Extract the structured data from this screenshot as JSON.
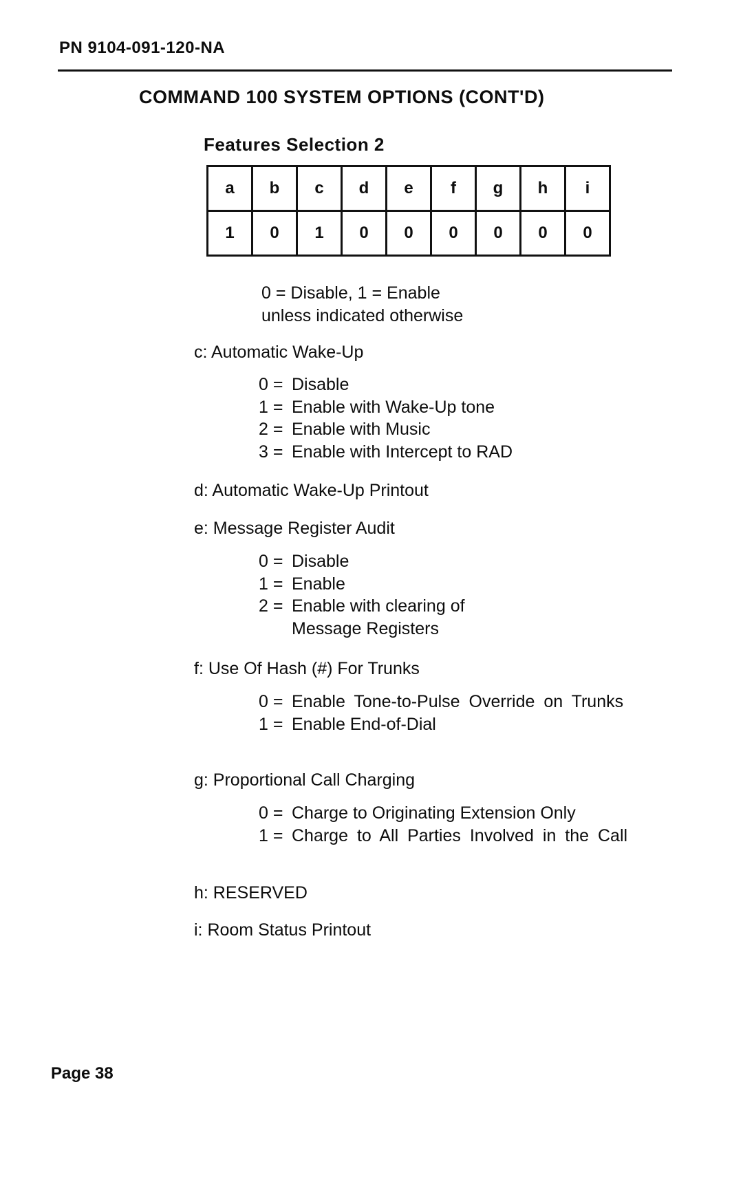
{
  "header": {
    "part_number": "PN 9104-091-120-NA",
    "title": "COMMAND 100 SYSTEM OPTIONS (CONT'D)",
    "subtitle": "Features Selection 2"
  },
  "bit_table": {
    "headers": [
      "a",
      "b",
      "c",
      "d",
      "e",
      "f",
      "g",
      "h",
      "i"
    ],
    "values": [
      "1",
      "0",
      "1",
      "0",
      "0",
      "0",
      "0",
      "0",
      "0"
    ]
  },
  "note": {
    "line1": "0 = Disable, 1 = Enable",
    "line2": "unless indicated otherwise"
  },
  "sections": [
    {
      "label": "c: Automatic Wake-Up",
      "options": [
        {
          "key": "0 =",
          "text": "Disable"
        },
        {
          "key": "1 =",
          "text": "Enable with Wake-Up tone"
        },
        {
          "key": "2 =",
          "text": "Enable with Music"
        },
        {
          "key": "3 =",
          "text": "Enable with Intercept to RAD"
        }
      ]
    },
    {
      "label": "d: Automatic Wake-Up Printout",
      "options": []
    },
    {
      "label": "e: Message Register Audit",
      "options": [
        {
          "key": "0 =",
          "text": "Disable"
        },
        {
          "key": "1 =",
          "text": "Enable"
        },
        {
          "key": "2 =",
          "text": "Enable with clearing of Message Registers"
        }
      ]
    },
    {
      "label": "f: Use Of Hash (#) For Trunks",
      "options": [
        {
          "key": "0 =",
          "text": "Enable Tone-to-Pulse Override on Trunks"
        },
        {
          "key": "1 =",
          "text": "Enable End-of-Dial"
        }
      ]
    },
    {
      "label": "g: Proportional Call Charging",
      "options": [
        {
          "key": "0 =",
          "text": "Charge to Originating Extension Only"
        },
        {
          "key": "1 =",
          "text": "Charge to All Parties Involved in the Call"
        }
      ]
    },
    {
      "label": "h: RESERVED",
      "options": []
    },
    {
      "label": "i: Room Status Printout",
      "options": []
    }
  ],
  "footer": {
    "page_label": "Page 38"
  }
}
